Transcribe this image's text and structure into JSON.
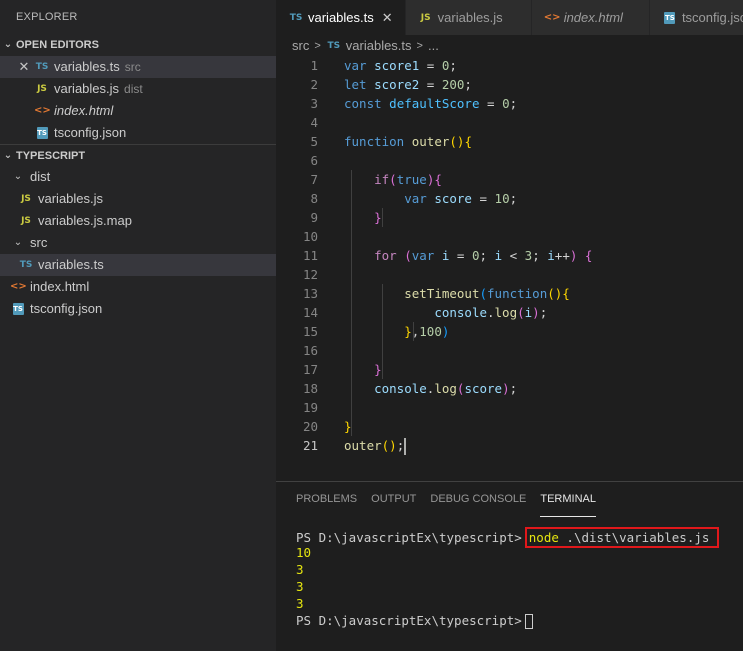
{
  "explorer": {
    "title": "EXPLORER",
    "open_editors": {
      "header": "OPEN EDITORS",
      "items": [
        {
          "name": "variables.ts",
          "detail": "src",
          "icon": "ts-icon"
        },
        {
          "name": "variables.js",
          "detail": "dist",
          "icon": "js-icon"
        },
        {
          "name": "index.html",
          "detail": "",
          "icon": "html-icon"
        },
        {
          "name": "tsconfig.json",
          "detail": "",
          "icon": "tsconfig-icon"
        }
      ]
    },
    "project": {
      "header": "TYPESCRIPT",
      "items": [
        {
          "name": "dist",
          "type": "folder"
        },
        {
          "name": "variables.js",
          "icon": "js-icon"
        },
        {
          "name": "variables.js.map",
          "icon": "js-icon"
        },
        {
          "name": "src",
          "type": "folder"
        },
        {
          "name": "variables.ts",
          "icon": "ts-icon"
        },
        {
          "name": "index.html",
          "icon": "html-icon"
        },
        {
          "name": "tsconfig.json",
          "icon": "tsconfig-icon"
        }
      ]
    }
  },
  "tabs": [
    {
      "label": "variables.ts",
      "active": true
    },
    {
      "label": "variables.js",
      "active": false
    },
    {
      "label": "index.html",
      "active": false
    },
    {
      "label": "tsconfig.json",
      "active": false
    }
  ],
  "icons": {
    "ts": "TS",
    "js": "JS",
    "html": "<>",
    "json": "TS",
    "close": "✕",
    "chevron_down": "⌄"
  },
  "breadcrumb": {
    "folder": "src",
    "file": "variables.ts",
    "more": "..."
  },
  "editor": {
    "line_numbers": [
      "1",
      "2",
      "3",
      "4",
      "5",
      "6",
      "7",
      "8",
      "9",
      "10",
      "11",
      "12",
      "13",
      "14",
      "15",
      "16",
      "17",
      "18",
      "19",
      "20",
      "21"
    ],
    "active_line": 21,
    "lines": [
      "var score1 = 0;",
      "let score2 = 200;",
      "const defaultScore = 0;",
      "",
      "function outer(){",
      "",
      "    if(true){",
      "        var score = 10;",
      "    }",
      "",
      "    for (var i = 0; i < 3; i++) {",
      "",
      "        setTimeout(function(){",
      "            console.log(i);",
      "        },100)",
      "",
      "    }",
      "    console.log(score);",
      "",
      "}",
      "outer();"
    ]
  },
  "panel": {
    "tabs": [
      "PROBLEMS",
      "OUTPUT",
      "DEBUG CONSOLE",
      "TERMINAL"
    ],
    "active_tab": "TERMINAL",
    "terminal": {
      "prompt": "PS D:\\javascriptEx\\typescript>",
      "command_node": "node",
      "command_args": " .\\dist\\variables.js",
      "output": [
        "10",
        "3",
        "3",
        "3"
      ]
    }
  },
  "colors": {
    "highlight_box": "#e0181b",
    "terminal_output": "#e5e510",
    "ts_blue": "#519aba"
  }
}
